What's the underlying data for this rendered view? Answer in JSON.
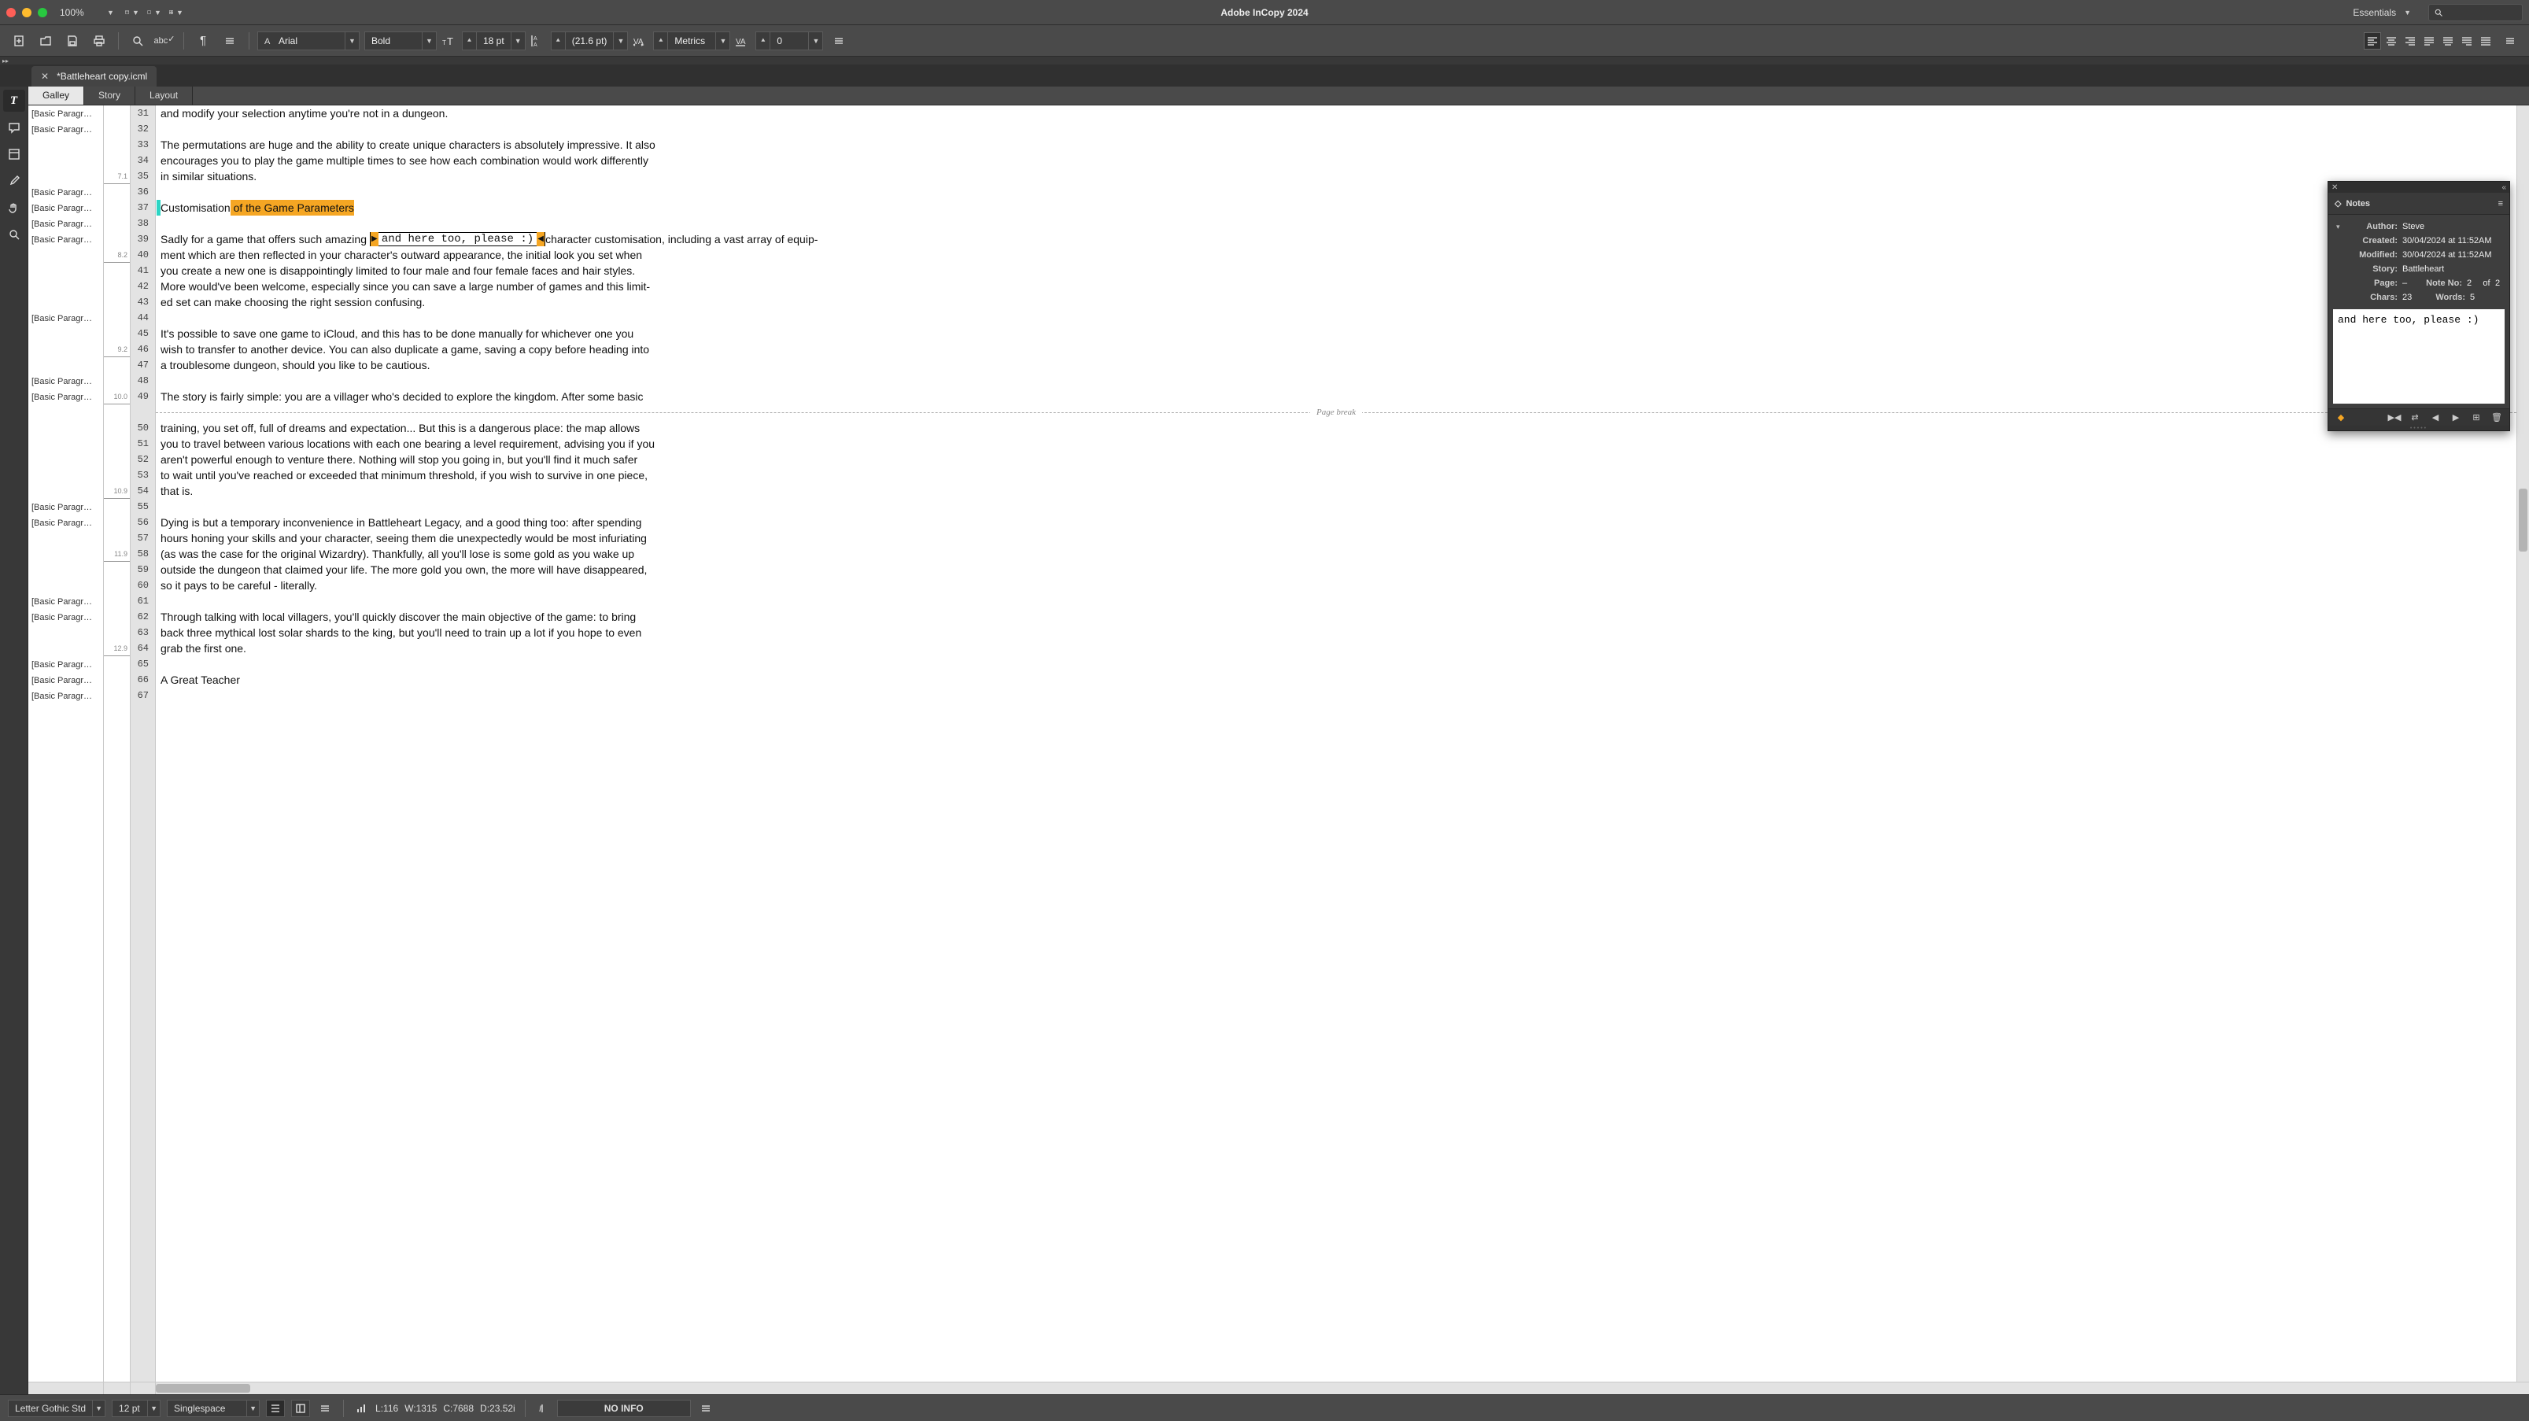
{
  "app": {
    "title": "Adobe InCopy 2024",
    "workspace": "Essentials",
    "zoom": "100%"
  },
  "doc": {
    "tab": "*Battleheart copy.icml"
  },
  "viewTabs": {
    "galley": "Galley",
    "story": "Story",
    "layout": "Layout",
    "active": "Galley"
  },
  "control": {
    "font": "Arial",
    "style": "Bold",
    "size": "18 pt",
    "leading": "(21.6 pt)",
    "kerning": "Metrics",
    "tracking": "0"
  },
  "styleLabel": "[Basic Paragr…",
  "measureTicks": {
    "31": "",
    "35": "7.1",
    "40": "8.2",
    "46": "9.2",
    "49": "10.0",
    "54": "10.9",
    "58": "11.9",
    "64": "12.9"
  },
  "lines": [
    {
      "n": 31,
      "style": true,
      "t": "and modify your selection anytime you're not in a dungeon."
    },
    {
      "n": 32,
      "style": true,
      "t": ""
    },
    {
      "n": 33,
      "style": false,
      "t": "The permutations are huge and the ability to create unique characters is absolutely impressive. It also"
    },
    {
      "n": 34,
      "style": false,
      "t": "encourages you to play the game multiple times to see how each combination would work differently"
    },
    {
      "n": 35,
      "style": false,
      "t": "in similar situations."
    },
    {
      "n": 36,
      "style": true,
      "t": ""
    },
    {
      "n": 37,
      "style": true,
      "heading": true,
      "pre": "Customisation",
      "hl": " of the Game Parameters"
    },
    {
      "n": 38,
      "style": true,
      "t": ""
    },
    {
      "n": 39,
      "style": true,
      "note": true,
      "pre": "Sadly for a game that offers such amazing ",
      "noteText": "and here too, please :)",
      "post": "character customisation, including a vast array of equip-"
    },
    {
      "n": 40,
      "style": false,
      "t": "ment which are then reflected in your character's outward appearance, the initial look you set when"
    },
    {
      "n": 41,
      "style": false,
      "t": "you create a new one is disappointingly limited to four male and four female faces and hair styles."
    },
    {
      "n": 42,
      "style": false,
      "t": "More would've been welcome, especially since you can save a large number of games and this limit-"
    },
    {
      "n": 43,
      "style": false,
      "t": "ed set can make choosing the right session confusing."
    },
    {
      "n": 44,
      "style": true,
      "t": ""
    },
    {
      "n": 45,
      "style": false,
      "t": "It's possible to save one game to iCloud, and this has to be done manually for whichever one you"
    },
    {
      "n": 46,
      "style": false,
      "t": "wish to transfer to another device. You can also duplicate a game, saving a copy before heading into"
    },
    {
      "n": 47,
      "style": false,
      "t": "a troublesome dungeon, should you like to be cautious."
    },
    {
      "n": 48,
      "style": true,
      "t": ""
    },
    {
      "n": 49,
      "style": true,
      "t": "The story is fairly simple: you are a villager who's decided to explore the kingdom. After some basic"
    },
    {
      "n": "pb",
      "pagebreak": true,
      "label": "Page break"
    },
    {
      "n": 50,
      "style": false,
      "t": "training, you set off, full of dreams and expectation... But this is a dangerous place: the map allows"
    },
    {
      "n": 51,
      "style": false,
      "t": "you to travel between various locations with each one bearing a level requirement, advising you if you"
    },
    {
      "n": 52,
      "style": false,
      "t": "aren't powerful enough to venture there. Nothing will stop you going in, but you'll find it much safer"
    },
    {
      "n": 53,
      "style": false,
      "t": "to wait until you've reached or exceeded that minimum threshold, if you wish to survive in one piece,"
    },
    {
      "n": 54,
      "style": false,
      "t": "that is."
    },
    {
      "n": 55,
      "style": true,
      "t": ""
    },
    {
      "n": 56,
      "style": true,
      "t": "Dying is but a temporary inconvenience in Battleheart Legacy, and a good thing too: after spending"
    },
    {
      "n": 57,
      "style": false,
      "t": "hours honing your skills and your character, seeing them die unexpectedly would be most infuriating"
    },
    {
      "n": 58,
      "style": false,
      "t": "(as was the case for the original Wizardry). Thankfully, all you'll lose is some gold as you wake up"
    },
    {
      "n": 59,
      "style": false,
      "t": "outside the dungeon that claimed your life. The more gold you own, the more will have disappeared,"
    },
    {
      "n": 60,
      "style": false,
      "t": "so it pays to be careful - literally."
    },
    {
      "n": 61,
      "style": true,
      "t": ""
    },
    {
      "n": 62,
      "style": true,
      "t": "Through talking with local villagers, you'll quickly discover the main objective of the game: to bring"
    },
    {
      "n": 63,
      "style": false,
      "t": "back three mythical lost solar shards to the king, but you'll need to train up a lot if you hope to even"
    },
    {
      "n": 64,
      "style": false,
      "t": "grab the first one."
    },
    {
      "n": 65,
      "style": true,
      "t": ""
    },
    {
      "n": 66,
      "style": true,
      "t": "A Great Teacher"
    },
    {
      "n": 67,
      "style": true,
      "t": ""
    }
  ],
  "notes": {
    "title": "Notes",
    "author_k": "Author:",
    "author": "Steve",
    "created_k": "Created:",
    "created": "30/04/2024 at 11:52AM",
    "modified_k": "Modified:",
    "modified": "30/04/2024 at 11:52AM",
    "story_k": "Story:",
    "story": "Battleheart",
    "page_k": "Page:",
    "page": "–",
    "noteno_k": "Note No:",
    "noteno": "2",
    "of_k": "of",
    "of": "2",
    "chars_k": "Chars:",
    "chars": "23",
    "words_k": "Words:",
    "words": "5",
    "content": "and here too, please :)"
  },
  "status": {
    "font": "Letter Gothic Std",
    "size": "12 pt",
    "leading": "Singlespace",
    "L": "L:116",
    "W": "W:1315",
    "C": "C:7688",
    "D": "D:23.52i",
    "info": "NO INFO"
  }
}
